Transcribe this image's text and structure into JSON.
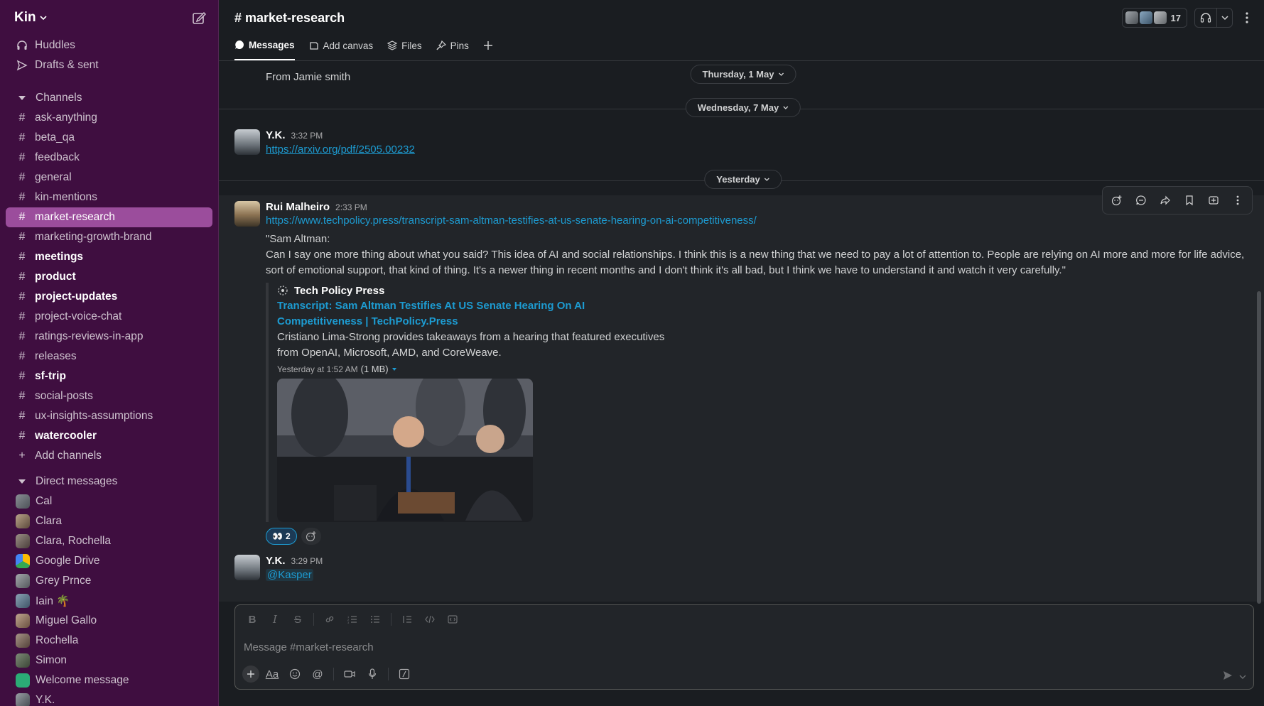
{
  "workspace": {
    "name": "Kin"
  },
  "sidebar": {
    "top_items": [
      {
        "label": "Huddles"
      },
      {
        "label": "Drafts & sent"
      }
    ],
    "channels_header": "Channels",
    "channels": [
      {
        "label": "ask-anything"
      },
      {
        "label": "beta_qa"
      },
      {
        "label": "feedback"
      },
      {
        "label": "general"
      },
      {
        "label": "kin-mentions"
      },
      {
        "label": "market-research"
      },
      {
        "label": "marketing-growth-brand"
      },
      {
        "label": "meetings"
      },
      {
        "label": "product"
      },
      {
        "label": "project-updates"
      },
      {
        "label": "project-voice-chat"
      },
      {
        "label": "ratings-reviews-in-app"
      },
      {
        "label": "releases"
      },
      {
        "label": "sf-trip"
      },
      {
        "label": "social-posts"
      },
      {
        "label": "ux-insights-assumptions"
      },
      {
        "label": "watercooler"
      }
    ],
    "add_channels": "Add channels",
    "dm_header": "Direct messages",
    "dms": [
      {
        "label": "Cal"
      },
      {
        "label": "Clara"
      },
      {
        "label": "Clara, Rochella"
      },
      {
        "label": "Google Drive"
      },
      {
        "label": "Grey Prnce"
      },
      {
        "label": "Iain 🌴"
      },
      {
        "label": "Miguel Gallo"
      },
      {
        "label": "Rochella"
      },
      {
        "label": "Simon"
      },
      {
        "label": "Welcome message"
      },
      {
        "label": "Y.K."
      }
    ]
  },
  "header": {
    "channel_title": "# market-research",
    "member_count": "17"
  },
  "tabs": [
    {
      "label": "Messages"
    },
    {
      "label": "Add canvas"
    },
    {
      "label": "Files"
    },
    {
      "label": "Pins"
    }
  ],
  "messages": {
    "partial_text": "From Jamie smith",
    "dates": {
      "d1": "Thursday, 1 May",
      "d2": "Wednesday, 7 May",
      "d3": "Yesterday"
    },
    "m1": {
      "author": "Y.K.",
      "time": "3:32 PM",
      "link": "https://arxiv.org/pdf/2505.00232"
    },
    "m2": {
      "author": "Rui Malheiro",
      "time": "2:33 PM",
      "link": "https://www.techpolicy.press/transcript-sam-altman-testifies-at-us-senate-hearing-on-ai-competitiveness/",
      "quote_head": "\"Sam Altman:",
      "quote_body": "Can I say one more thing about what you said? This idea of AI and social relationships. I think this is a new thing that we need to pay a lot of attention to. People are relying on AI more and more for life advice, sort of emotional support, that kind of thing. It's a newer thing in recent months and I don't think it's all bad, but I think we have to understand it and watch it very carefully.\"",
      "unfurl_site": "Tech Policy Press",
      "unfurl_title": "Transcript: Sam Altman Testifies At US Senate Hearing On AI Competitiveness | TechPolicy.Press",
      "unfurl_desc": "Cristiano Lima-Strong provides takeaways from a hearing that featured executives from OpenAI, Microsoft, AMD, and CoreWeave.",
      "unfurl_meta": "Yesterday at 1:52 AM",
      "unfurl_size": "(1 MB)",
      "reaction_count": "2"
    },
    "m3": {
      "author": "Y.K.",
      "time": "3:29 PM",
      "mention": "@Kasper"
    }
  },
  "composer": {
    "placeholder": "Message #market-research"
  },
  "colors": {
    "sidebar": "#3f0e40",
    "active": "#9b4d9c",
    "link": "#1d9bd1",
    "bg": "#1a1d21"
  }
}
